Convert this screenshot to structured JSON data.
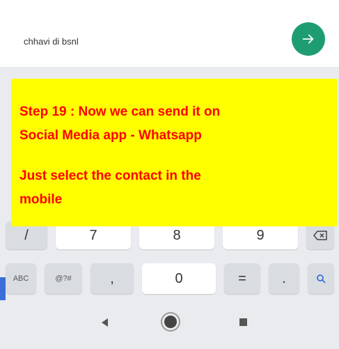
{
  "search": {
    "value": "chhavi di bsnl"
  },
  "send_button": {
    "icon": "arrow-right-icon",
    "color": "#1f9d72"
  },
  "overlay": {
    "line1": "Step 19 :  Now we can send it on",
    "line2": "Social Media app - Whatsapp",
    "line3": "Just select the contact in the",
    "line4": "mobile",
    "bg_color": "#ffff00",
    "text_color": "#ff0000"
  },
  "keyboard": {
    "row3": [
      "/",
      "7",
      "8",
      "9"
    ],
    "row3_backspace_icon": "backspace-icon",
    "row4": [
      "ABC",
      "@?#",
      ",",
      "0",
      "=",
      "."
    ],
    "row4_search_icon": "search-icon"
  },
  "navbar": {
    "back_icon": "back-triangle-icon",
    "home_icon": "home-circle-icon",
    "recent_icon": "recent-square-icon"
  }
}
